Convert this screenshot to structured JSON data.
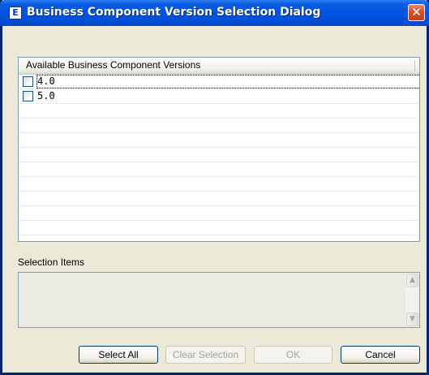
{
  "window": {
    "title": "Business Component Version Selection Dialog",
    "icon_letter": "E",
    "close_glyph": "✕"
  },
  "versions": {
    "header": "Available Business Component Versions",
    "items": [
      {
        "label": "4.0",
        "checked": false
      },
      {
        "label": "5.0",
        "checked": false
      }
    ]
  },
  "selection": {
    "label": "Selection Items"
  },
  "buttons": {
    "select_all": "Select All",
    "clear_selection": "Clear Selection",
    "ok": "OK",
    "cancel": "Cancel"
  },
  "colors": {
    "titlebar": "#0054e3",
    "close_button": "#d8552f",
    "dialog_background": "#ece9d8",
    "border": "#7f9db9"
  }
}
